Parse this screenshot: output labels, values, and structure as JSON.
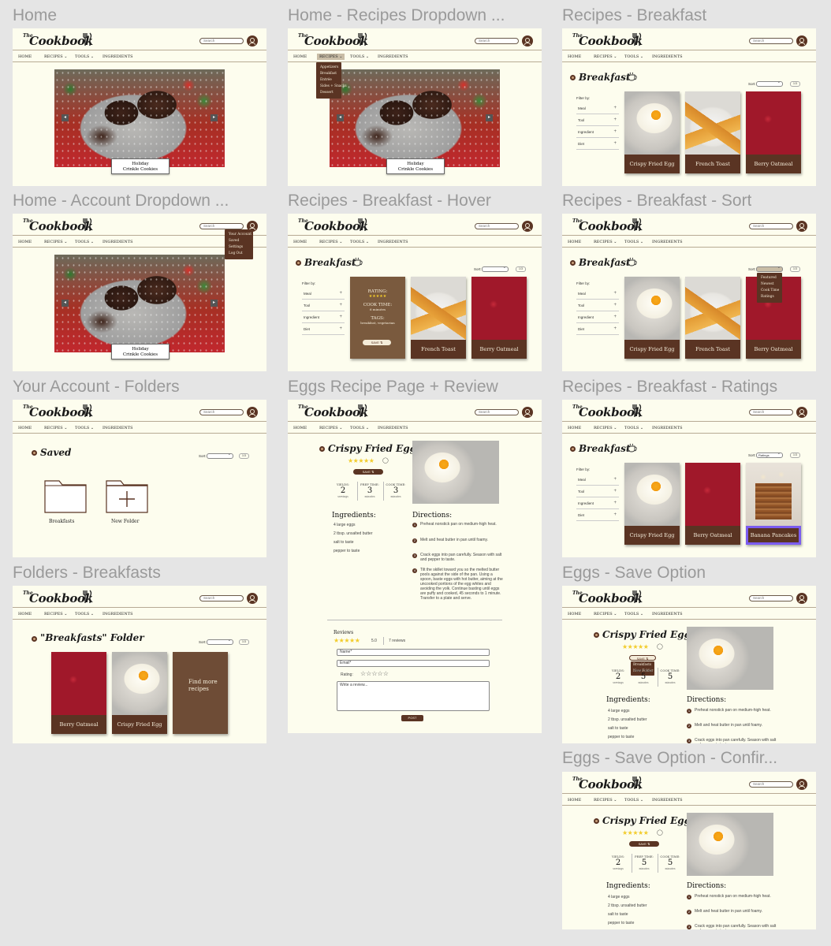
{
  "titles": [
    "Home",
    "Home - Recipes Dropdown ...",
    "Recipes - Breakfast",
    "Home - Account Dropdown ...",
    "Recipes - Breakfast - Hover",
    "Recipes - Breakfast - Sort",
    "Your Account - Folders",
    "Eggs Recipe Page + Review",
    "Recipes - Breakfast - Ratings",
    "Folders - Breakfasts",
    "Eggs - Save Option",
    "Eggs - Save Option - Confir..."
  ],
  "brand": {
    "the": "The",
    "name": "Cookbook"
  },
  "search_placeholder": "Search",
  "nav": {
    "home": "HOME",
    "recipes": "RECIPES ⌄",
    "tools": "TOOLS ⌄",
    "ingredients": "INGREDIENTS"
  },
  "hero_caption": {
    "line1": "Holiday",
    "line2": "Crinkle Cookies"
  },
  "recipes_menu": [
    "Appetizers",
    "Breakfast",
    "Entrée",
    "Sides + Snacks",
    "Dessert"
  ],
  "account_menu": [
    "Your Account",
    "Saved",
    "Settings",
    "Log Out"
  ],
  "breakfast": {
    "title": "Breakfast",
    "sort": "Sort:",
    "page": "1/3",
    "filter_by": "Filter by:",
    "filters": [
      "Meal",
      "Tool",
      "Ingredient",
      "Diet"
    ]
  },
  "cards": {
    "egg": "Crispy Fried Egg",
    "toast": "French Toast",
    "oat": "Berry Oatmeal",
    "pancake": "Banana Pancakes"
  },
  "hover": {
    "rating": "RATING:",
    "cook": "COOK TIME:",
    "cook_v": "6 minutes",
    "tags": "TAGS:",
    "tags_v": "breakfast, vegetarian",
    "save": "SAVE ⇅"
  },
  "sort_menu": [
    "Featured",
    "Newest",
    "Cook Time",
    "Ratings"
  ],
  "ratings_sort": "Ratings",
  "saved": {
    "title": "Saved",
    "folder1": "Breakfasts",
    "folder2": "New Folder"
  },
  "folder_page": {
    "title": "\"Breakfasts\" Folder",
    "find": "Find more recipes"
  },
  "recipe": {
    "title": "Crispy Fried Eggs",
    "save": "SAVE ⇅",
    "yields_l": "YIELDS:",
    "yields_v": "2",
    "yields_u": "servings",
    "prep_l": "PREP TIME:",
    "prep_v": "3",
    "prep_u": "minutes",
    "cook_l": "COOK TIME:",
    "cook_v": "3",
    "cook_u": "minutes",
    "ingredients_title": "Ingredients:",
    "ingredients": [
      "4 large eggs",
      "2 tbsp. unsalted butter",
      "salt to taste",
      "pepper to taste"
    ],
    "directions_title": "Directions:",
    "directions": [
      "Preheat nonstick pan on medium-high heat.",
      "Melt and heat butter in pan until foamy.",
      "Crack eggs into pan carefully. Season with salt and pepper to taste.",
      "Tilt the skillet toward you so the melted butter pools against the side of the pan. Using a spoon, baste eggs with hot butter, aiming at the uncooked portions of the egg whites and avoiding the yolk. Continue basting until eggs are puffy and cooked, 45 seconds to 1 minute. Transfer to a plate and serve."
    ],
    "reviews": "Reviews",
    "score": "5.0",
    "count": "7 reviews",
    "name_ph": "Name*",
    "email_ph": "Email*",
    "rating_l": "Rating:",
    "review_ph": "Write a review...",
    "post": "POST"
  },
  "save_option": {
    "prep_v": "5",
    "cook_v": "5",
    "menu": [
      "Breakfasts",
      "New Folder"
    ]
  }
}
